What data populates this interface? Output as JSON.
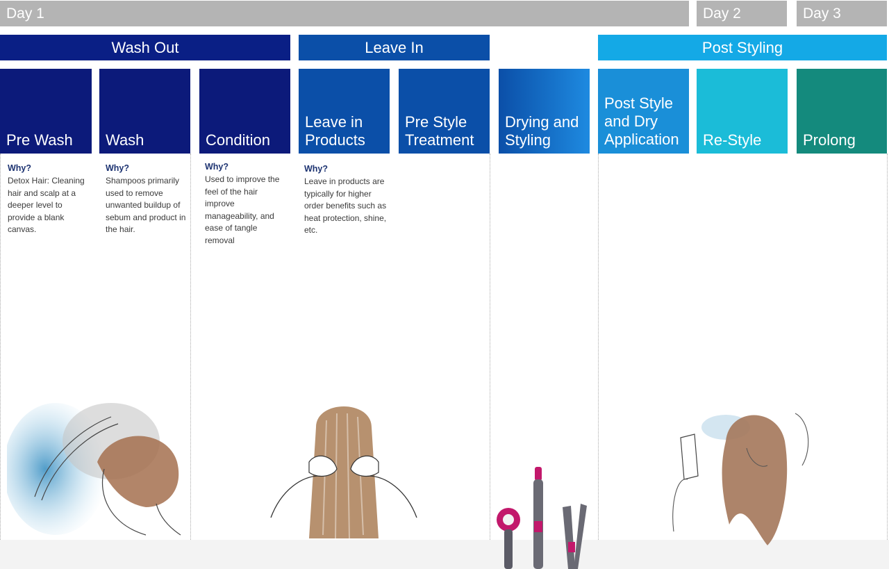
{
  "days": [
    {
      "label": "Day 1"
    },
    {
      "label": "Day 2"
    },
    {
      "label": "Day 3"
    }
  ],
  "groups": [
    {
      "label": "Wash Out",
      "color": "#0a1f85"
    },
    {
      "label": "Leave In",
      "color": "#0b4fa8"
    },
    {
      "label": "Post Styling",
      "color": "#14a9e6"
    }
  ],
  "steps": [
    {
      "label": "Pre Wash",
      "color": "#0c1a7a",
      "why_heading": "Why?",
      "why_text": "Detox Hair: Cleaning hair and scalp at a deeper level to provide a blank canvas."
    },
    {
      "label": "Wash",
      "color": "#0c1a7a",
      "why_heading": "Why?",
      "why_text": "Shampoos primarily used to remove unwanted buildup of sebum and product in the hair."
    },
    {
      "label": "Condition",
      "color": "#0c1a7a",
      "why_heading": "Why?",
      "why_text": "Used to improve the feel of the hair improve manageability, and ease of tangle removal"
    },
    {
      "label": "Leave in Products",
      "color": "#0b4fa8",
      "why_heading": "Why?",
      "why_text": "Leave in products are typically for higher order benefits such as heat protection, shine, etc."
    },
    {
      "label": "Pre Style Treatment",
      "color": "#0b4fa8",
      "why_heading": "",
      "why_text": ""
    },
    {
      "label": "Drying and Styling",
      "color": "#1f7fd4",
      "why_heading": "",
      "why_text": ""
    },
    {
      "label": "Post Style and Dry Application",
      "color": "#1a8fd8",
      "why_heading": "",
      "why_text": ""
    },
    {
      "label": "Re-Style",
      "color": "#1bbcd8",
      "why_heading": "",
      "why_text": ""
    },
    {
      "label": "Prolong",
      "color": "#148a7d",
      "why_heading": "",
      "why_text": ""
    }
  ],
  "illustrations": [
    {
      "icon": "hair-wash-illustration-icon"
    },
    {
      "icon": "hair-back-illustration-icon"
    },
    {
      "icon": "styling-tools-illustration-icon"
    },
    {
      "icon": "hairspray-illustration-icon"
    }
  ]
}
